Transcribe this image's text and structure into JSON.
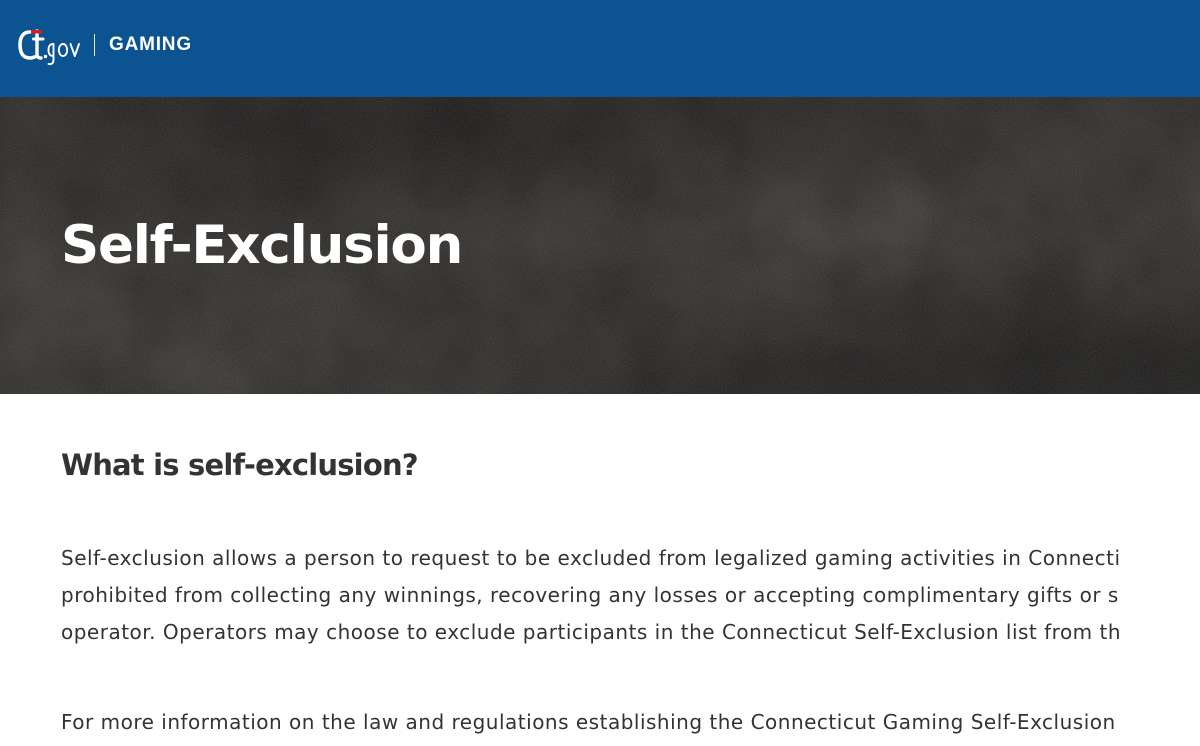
{
  "header": {
    "logo_text": "Ct.gov",
    "site_name": "GAMING",
    "background_color": "#0b5391"
  },
  "hero": {
    "title": "Self-Exclusion"
  },
  "content": {
    "section_title": "What is self-exclusion?",
    "paragraph1_lines": [
      "Self-exclusion allows a person to request to be excluded from legalized gaming activities in Connecti",
      "prohibited from collecting any winnings, recovering any losses or accepting complimentary gifts or s",
      "operator. Operators may choose to exclude participants in the Connecticut Self-Exclusion list from th"
    ],
    "paragraph2_lines": [
      "For more information on the law and regulations establishing the Connecticut Gaming Self-Exclusion"
    ]
  }
}
